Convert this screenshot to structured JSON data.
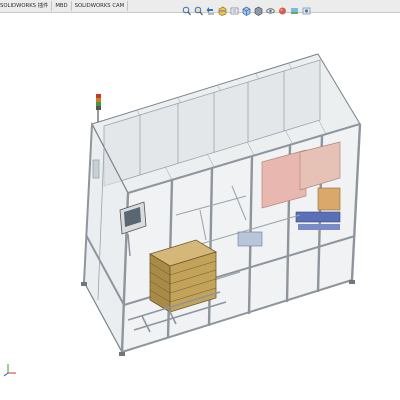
{
  "command_manager": {
    "tabs": [
      {
        "label": "SOLIDWORKS 插件"
      },
      {
        "label": "MBD"
      },
      {
        "label": "SOLIDWORKS CAM"
      }
    ]
  },
  "heads_up_toolbar": {
    "icons": [
      "zoom-to-fit-icon",
      "zoom-to-area-icon",
      "previous-view-icon",
      "section-view-icon",
      "dynamic-annotation-icon",
      "view-orientation-icon",
      "display-style-icon",
      "hide-show-items-icon",
      "edit-appearance-icon",
      "apply-scene-icon",
      "view-settings-icon"
    ]
  },
  "graphics_area": {
    "model": "machine-enclosure-assembly",
    "background": "#ffffff",
    "colors": {
      "frame": "#8e959c",
      "glass": "#dfe3e6",
      "roof": "#eceff0",
      "pallet_box": "#b89a55",
      "pink_panel": "#e8b8b0",
      "blue_parts": "#5a6fb5",
      "tower_red": "#c43a2c",
      "tower_green": "#3f9a3f",
      "tower_orange": "#d07a22"
    }
  },
  "triad": {
    "axes": [
      "x",
      "y",
      "z"
    ]
  }
}
